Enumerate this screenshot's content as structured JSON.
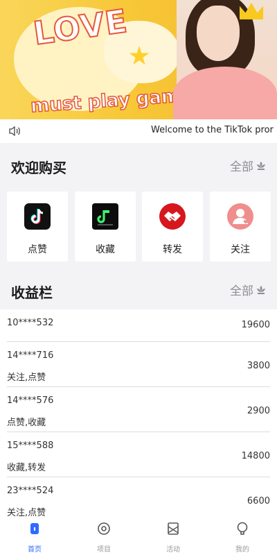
{
  "banner": {
    "love_text": "LOVE",
    "tagline": "must play games"
  },
  "notice": {
    "text": "Welcome to the TikTok pror"
  },
  "shop_section": {
    "title": "欢迎购买",
    "more_label": "全部"
  },
  "shop_items": [
    {
      "label": "点赞",
      "icon": "tiktok-icon"
    },
    {
      "label": "收藏",
      "icon": "music-app-icon"
    },
    {
      "label": "转发",
      "icon": "handshake-icon"
    },
    {
      "label": "关注",
      "icon": "follow-user-icon"
    }
  ],
  "earnings_section": {
    "title": "收益栏",
    "more_label": "全部"
  },
  "earnings": [
    {
      "account": "10****532",
      "tags": "",
      "amount": "19600"
    },
    {
      "account": "14****716",
      "tags": "关注,点赞",
      "amount": "3800"
    },
    {
      "account": "14****576",
      "tags": "点赞,收藏",
      "amount": "2900"
    },
    {
      "account": "15****588",
      "tags": "收藏,转发",
      "amount": "14800"
    },
    {
      "account": "23****524",
      "tags": "关注,点赞",
      "amount": "6600"
    }
  ],
  "tabbar": [
    {
      "label": "首页",
      "icon": "home-icon",
      "active": true
    },
    {
      "label": "项目",
      "icon": "project-icon",
      "active": false
    },
    {
      "label": "活动",
      "icon": "activity-icon",
      "active": false
    },
    {
      "label": "我的",
      "icon": "profile-icon",
      "active": false
    }
  ],
  "colors": {
    "accent": "#2f6bff",
    "banner_yellow": "#f7c838",
    "muted": "#8d8d95"
  }
}
